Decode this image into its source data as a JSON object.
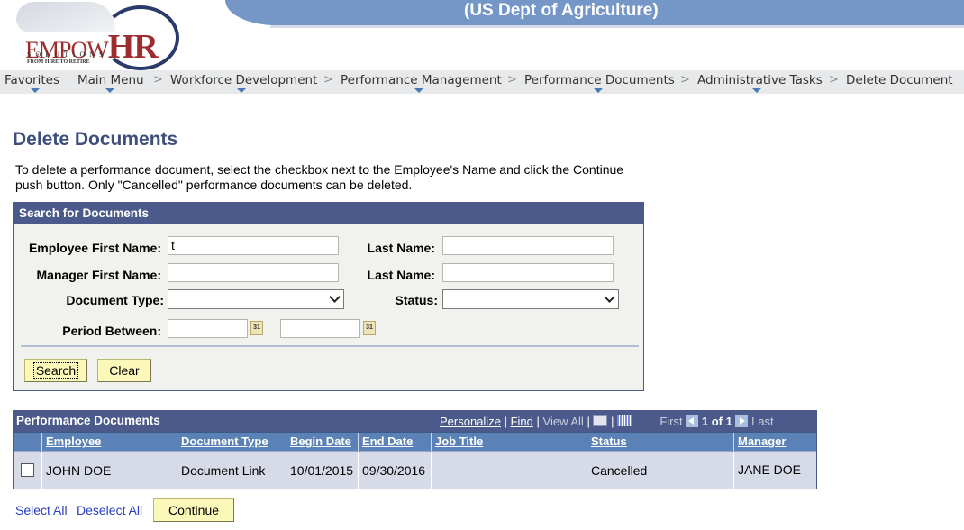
{
  "header": {
    "org_title": "(US Dept of Agriculture)",
    "logo": {
      "brand_part1": "EMPOW",
      "brand_part2": "HR",
      "subtitle": "SOLUTIONS",
      "tagline": "FROM HIRE TO RETIRE"
    }
  },
  "nav": {
    "items": [
      {
        "label": "Favorites",
        "has_menu": true
      },
      {
        "label": "Main Menu",
        "has_menu": true
      },
      {
        "label": "Workforce Development",
        "has_menu": true
      },
      {
        "label": "Performance Management",
        "has_menu": true
      },
      {
        "label": "Performance Documents",
        "has_menu": true
      },
      {
        "label": "Administrative Tasks",
        "has_menu": true
      },
      {
        "label": "Delete Document",
        "has_menu": false
      }
    ],
    "separator": ">"
  },
  "page": {
    "title": "Delete Documents",
    "instructions": "To delete a performance document, select the checkbox next to the Employee's Name and click the Continue push button. Only \"Cancelled\" performance documents can be deleted."
  },
  "search": {
    "title": "Search for Documents",
    "employee_first_name": {
      "label": "Employee First Name:",
      "value": "t"
    },
    "employee_last_name": {
      "label": "Last Name:",
      "value": ""
    },
    "manager_first_name": {
      "label": "Manager First Name:",
      "value": ""
    },
    "manager_last_name": {
      "label": "Last Name:",
      "value": ""
    },
    "document_type": {
      "label": "Document Type:",
      "value": ""
    },
    "status": {
      "label": "Status:",
      "value": ""
    },
    "period": {
      "label": "Period Between:",
      "from": "",
      "to": "",
      "calendar_icon_text": "31"
    },
    "search_button": "Search",
    "clear_button": "Clear"
  },
  "grid": {
    "title": "Performance Documents",
    "tools": {
      "personalize": "Personalize",
      "find": "Find",
      "view_all": "View All",
      "sep": "|"
    },
    "pagination": {
      "first": "First",
      "range": "1 of 1",
      "last": "Last"
    },
    "columns": [
      "Employee",
      "Document Type",
      "Begin Date",
      "End Date",
      "Job Title",
      "Status",
      "Manager"
    ],
    "rows": [
      {
        "checked": false,
        "employee": "JOHN DOE",
        "document_type": "Document Link",
        "begin_date": "10/01/2015",
        "end_date": "09/30/2016",
        "job_title": "",
        "status": "Cancelled",
        "manager": "JANE DOE"
      }
    ]
  },
  "footer": {
    "select_all": "Select All",
    "deselect_all": "Deselect All",
    "continue_button": "Continue"
  },
  "colors": {
    "banner": "#7497c8",
    "box_header": "#4b5a8a",
    "column_header": "#5a82b6",
    "row_bg": "#d6dbe7",
    "title_color": "#3e4f7c",
    "button_bg": "#fbf8b9",
    "link": "#2a3ebd"
  }
}
